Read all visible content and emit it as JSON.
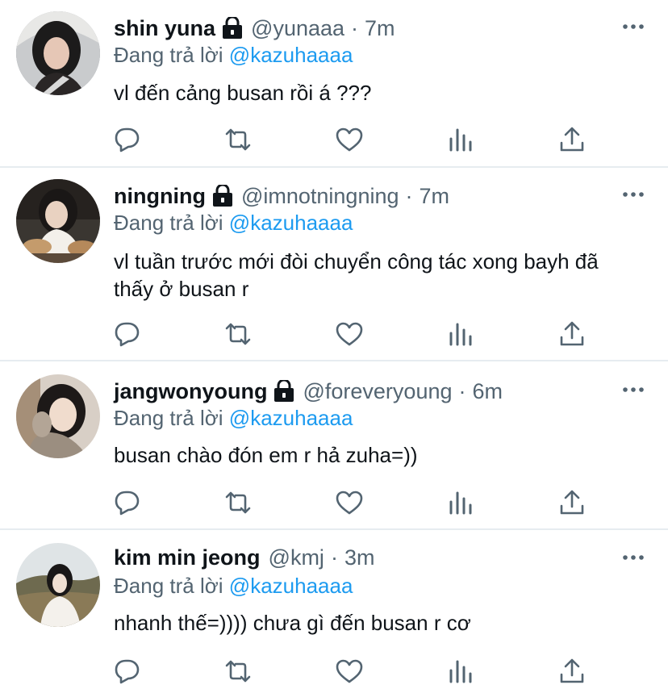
{
  "reply_prefix": "Đang trả lời",
  "colors": {
    "mention": "#1d9bf0",
    "secondary": "#536471",
    "divider": "#e6ecf0",
    "text": "#0f1419"
  },
  "tweets": [
    {
      "name": "shin yuna",
      "locked": true,
      "handle": "@yunaaa",
      "time": "7m",
      "reply_to": "@kazuhaaaa",
      "text": "vl đến cảng busan rồi á ???",
      "avatar_icon": "profile-photo"
    },
    {
      "name": "ningning",
      "locked": true,
      "handle": "@imnotningning",
      "time": "7m",
      "reply_to": "@kazuhaaaa",
      "text": "vl tuần trước mới đòi chuyển công tác xong bayh đã thấy ở busan r",
      "avatar_icon": "profile-photo"
    },
    {
      "name": "jangwonyoung",
      "locked": true,
      "handle": "@foreveryoung",
      "time": "6m",
      "reply_to": "@kazuhaaaa",
      "text": "busan chào đón em r hả zuha=))",
      "avatar_icon": "profile-photo"
    },
    {
      "name": "kim min jeong",
      "locked": false,
      "handle": "@kmj",
      "time": "3m",
      "reply_to": "@kazuhaaaa",
      "text": "nhanh thế=)))) chưa gì đến busan r cơ",
      "avatar_icon": "profile-photo"
    }
  ],
  "action_icons": [
    "reply-icon",
    "retweet-icon",
    "like-icon",
    "analytics-icon",
    "share-icon"
  ],
  "dot_separator": "·"
}
